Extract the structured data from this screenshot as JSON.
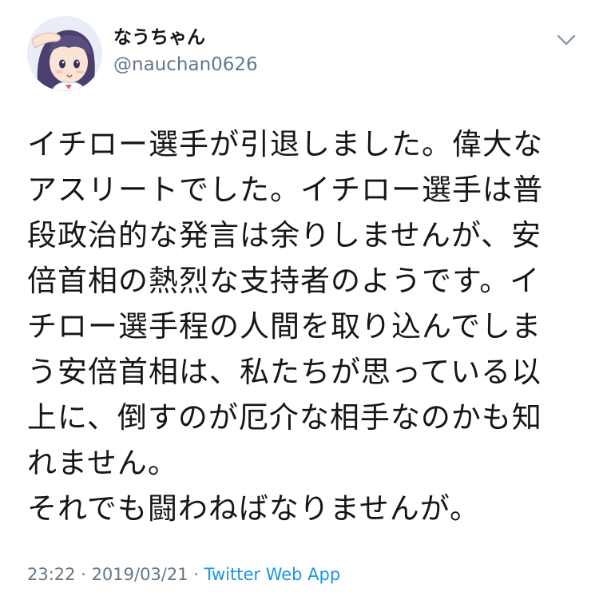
{
  "tweet": {
    "display_name": "なうちゃん",
    "handle": "@nauchan0626",
    "text_lines": [
      "イチロー選手が引退しました。偉大な",
      "アスリートでした。イチロー選手は普",
      "段政治的な発言は余りしませんが、安",
      "倍首相の熱烈な支持者のようです。イ",
      "チロー選手程の人間を取り込んでしま",
      "う安倍首相は、私たちが思っている以",
      "上に、倒すのが厄介な相手なのかも知",
      "れません。",
      "それでも闘わねばなりませんが。"
    ],
    "time": "23:22",
    "separator1": " · ",
    "date": "2019/03/21",
    "separator2": " · ",
    "source": "Twitter Web App"
  },
  "colors": {
    "text": "#14171a",
    "secondary": "#657786",
    "link": "#1b95e0",
    "background": "#ffffff"
  },
  "icons": {
    "avatar": "anime-girl-avatar",
    "menu": "chevron-down-icon"
  }
}
